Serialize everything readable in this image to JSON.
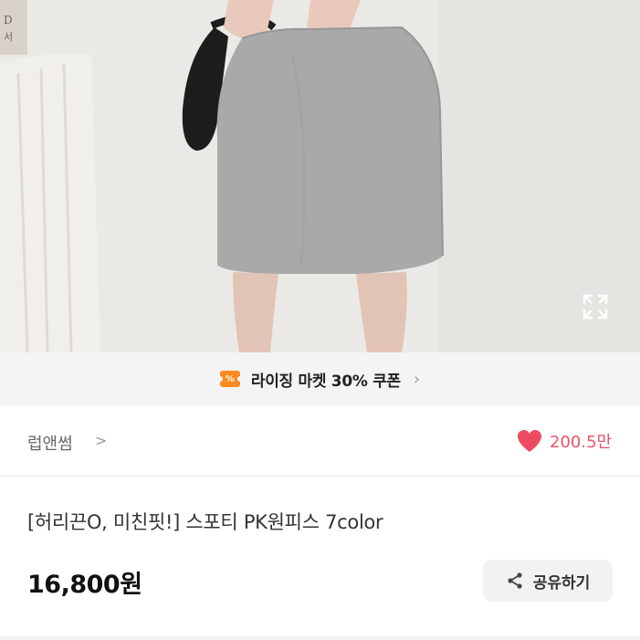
{
  "coupon": {
    "icon": "coupon-ticket-icon",
    "icon_glyph": "%",
    "text": "라이징 마켓 30% 쿠폰",
    "accent": "#ff8a1f"
  },
  "seller": {
    "name": "럽앤썸",
    "chevron": ">"
  },
  "like": {
    "icon": "heart-icon",
    "count": "200.5만",
    "color": "#e9546b"
  },
  "product": {
    "title": "[허리끈O, 미친핏!] 스포티 PK원피스 7color",
    "price": "16,800원"
  },
  "share": {
    "icon": "share-icon",
    "label": "공유하기"
  },
  "image": {
    "expand_icon": "expand-icon",
    "corner_text": "D\n서"
  }
}
